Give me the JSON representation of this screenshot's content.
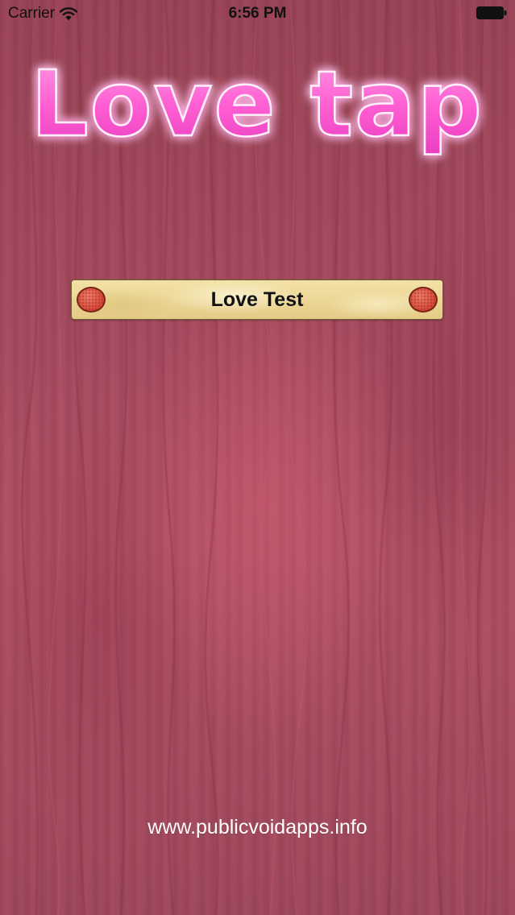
{
  "status_bar": {
    "carrier": "Carrier",
    "time": "6:56 PM",
    "wifi_icon": "wifi-icon",
    "battery_icon": "battery-icon"
  },
  "logo": {
    "text": "Love tap",
    "color": "#ff5fd2"
  },
  "main": {
    "love_test_label": "Love Test"
  },
  "footer": {
    "website": "www.publicvoidapps.info"
  },
  "colors": {
    "background_wood": "#a44a5c",
    "button_parchment": "#ecd797",
    "dot_red": "#d94836"
  }
}
